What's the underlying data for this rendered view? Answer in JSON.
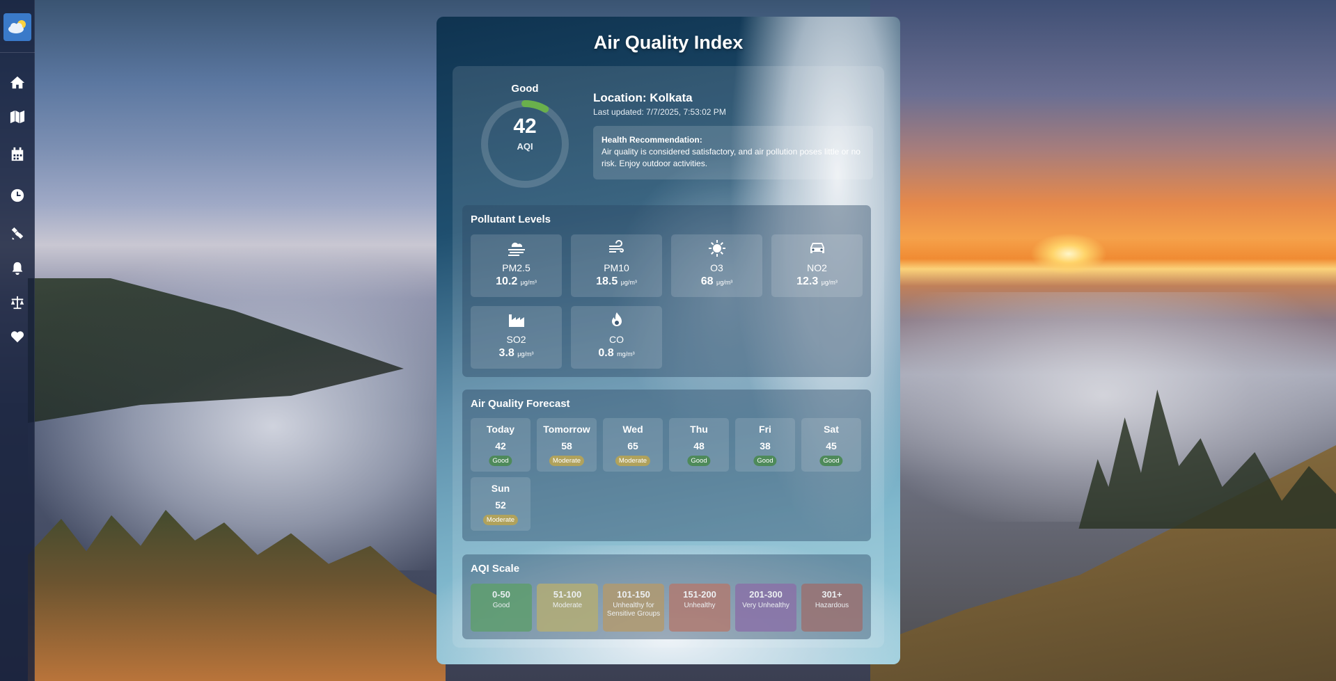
{
  "app": {
    "title": "Air Quality Index"
  },
  "sidebar": {
    "items": [
      {
        "icon": "home-icon"
      },
      {
        "icon": "map-icon"
      },
      {
        "icon": "calendar-icon"
      },
      {
        "icon": "clock-icon"
      },
      {
        "icon": "satellite-icon"
      },
      {
        "icon": "bell-icon"
      },
      {
        "icon": "scale-balance-icon"
      },
      {
        "icon": "heart-icon"
      }
    ]
  },
  "aqi": {
    "status": "Good",
    "value": "42",
    "unit": "AQI",
    "gauge_fraction": 0.084,
    "gauge_color": "#6ab04c"
  },
  "location": {
    "label": "Location: Kolkata",
    "last_updated": "Last updated: 7/7/2025, 7:53:02 PM"
  },
  "health": {
    "title": "Health Recommendation:",
    "text": "Air quality is considered satisfactory, and air pollution poses little or no risk. Enjoy outdoor activities."
  },
  "pollutants": {
    "title": "Pollutant Levels",
    "items": [
      {
        "name": "PM2.5",
        "value": "10.2",
        "unit": "μg/m³",
        "icon": "smog-icon"
      },
      {
        "name": "PM10",
        "value": "18.5",
        "unit": "μg/m³",
        "icon": "wind-icon"
      },
      {
        "name": "O3",
        "value": "68",
        "unit": "μg/m³",
        "icon": "sun-icon"
      },
      {
        "name": "NO2",
        "value": "12.3",
        "unit": "μg/m³",
        "icon": "car-icon"
      },
      {
        "name": "SO2",
        "value": "3.8",
        "unit": "μg/m³",
        "icon": "industry-icon"
      },
      {
        "name": "CO",
        "value": "0.8",
        "unit": "mg/m³",
        "icon": "fire-icon"
      }
    ]
  },
  "forecast": {
    "title": "Air Quality Forecast",
    "days": [
      {
        "day": "Today",
        "value": "42",
        "status": "Good"
      },
      {
        "day": "Tomorrow",
        "value": "58",
        "status": "Moderate"
      },
      {
        "day": "Wed",
        "value": "65",
        "status": "Moderate"
      },
      {
        "day": "Thu",
        "value": "48",
        "status": "Good"
      },
      {
        "day": "Fri",
        "value": "38",
        "status": "Good"
      },
      {
        "day": "Sat",
        "value": "45",
        "status": "Good"
      },
      {
        "day": "Sun",
        "value": "52",
        "status": "Moderate"
      }
    ]
  },
  "scale": {
    "title": "AQI Scale",
    "levels": [
      {
        "range": "0-50",
        "label": "Good",
        "color": "#5f9e6e"
      },
      {
        "range": "51-100",
        "label": "Moderate",
        "color": "#b3ad76"
      },
      {
        "range": "101-150",
        "label": "Unhealthy for Sensitive Groups",
        "color": "#b19a70"
      },
      {
        "range": "151-200",
        "label": "Unhealthy",
        "color": "#b07b72"
      },
      {
        "range": "201-300",
        "label": "Very Unhealthy",
        "color": "#8a72a8"
      },
      {
        "range": "301+",
        "label": "Hazardous",
        "color": "#9a7272"
      }
    ]
  }
}
